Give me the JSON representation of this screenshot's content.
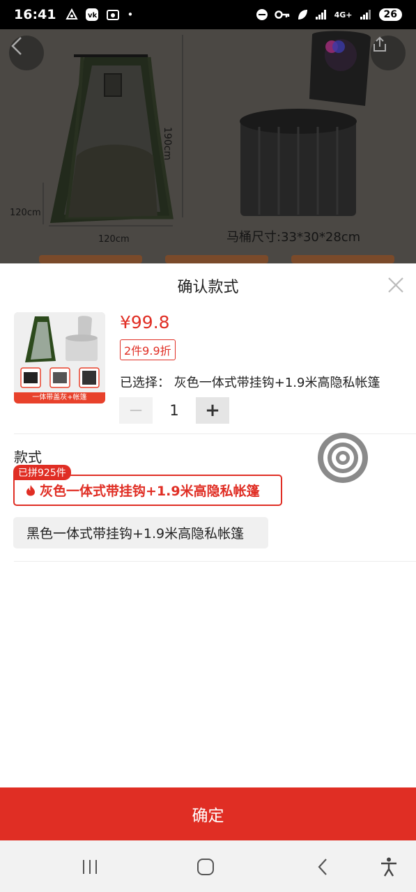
{
  "status_bar": {
    "time": "16:41",
    "network": "4G+",
    "battery": "26"
  },
  "hero": {
    "dim_height_label": "190cm",
    "dim_depth_label": "120cm",
    "dim_width_label": "120cm",
    "toilet_size_label": "马桶尺寸:33*30*28cm"
  },
  "sheet": {
    "title": "确认款式",
    "thumbnail_caption": "一体带盖灰+帐篷",
    "price": "¥99.8",
    "promo": "2件9.9折",
    "selected_label": "已选择：",
    "selected_value": "灰色一体式带挂钩+1.9米高隐私帐篷",
    "quantity": "1",
    "minus_label": "−",
    "plus_label": "+",
    "section_label": "款式",
    "options": [
      {
        "label": "灰色一体式带挂钩+1.9米高隐私帐篷",
        "badge": "已拼925件",
        "selected": true
      },
      {
        "label": "黑色一体式带挂钩+1.9米高隐私帐篷",
        "selected": false
      }
    ],
    "confirm_label": "确定"
  },
  "colors": {
    "accent": "#e02e24",
    "overlay": "#4b4844",
    "option_bg": "#f0f0f0"
  },
  "icons": {
    "back": "chevron-left-icon",
    "share": "share-icon",
    "close": "close-icon",
    "flame": "flame-icon",
    "floating_target": "target-icon",
    "nav_recent": "recent-apps-icon",
    "nav_home": "home-icon",
    "nav_back": "nav-back-icon",
    "nav_accessibility": "accessibility-icon"
  }
}
